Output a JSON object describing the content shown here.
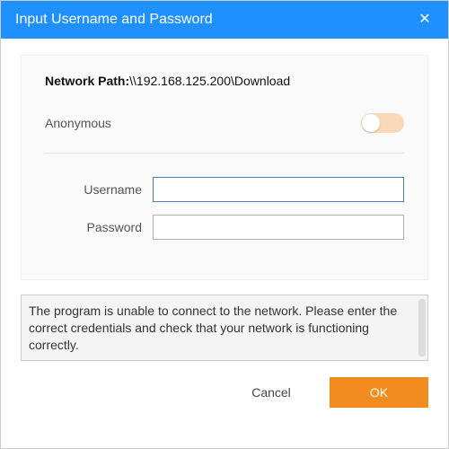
{
  "titlebar": {
    "title": "Input Username and Password",
    "close_icon": "✕"
  },
  "panel": {
    "network_path_label": "Network Path:",
    "network_path_value": "\\\\192.168.125.200\\Download",
    "anonymous_label": "Anonymous",
    "username_label": "Username",
    "password_label": "Password",
    "username_value": "",
    "password_value": ""
  },
  "message": "The program is unable to connect to the network. Please enter the correct credentials and check that your network is functioning correctly.",
  "buttons": {
    "cancel": "Cancel",
    "ok": "OK"
  }
}
